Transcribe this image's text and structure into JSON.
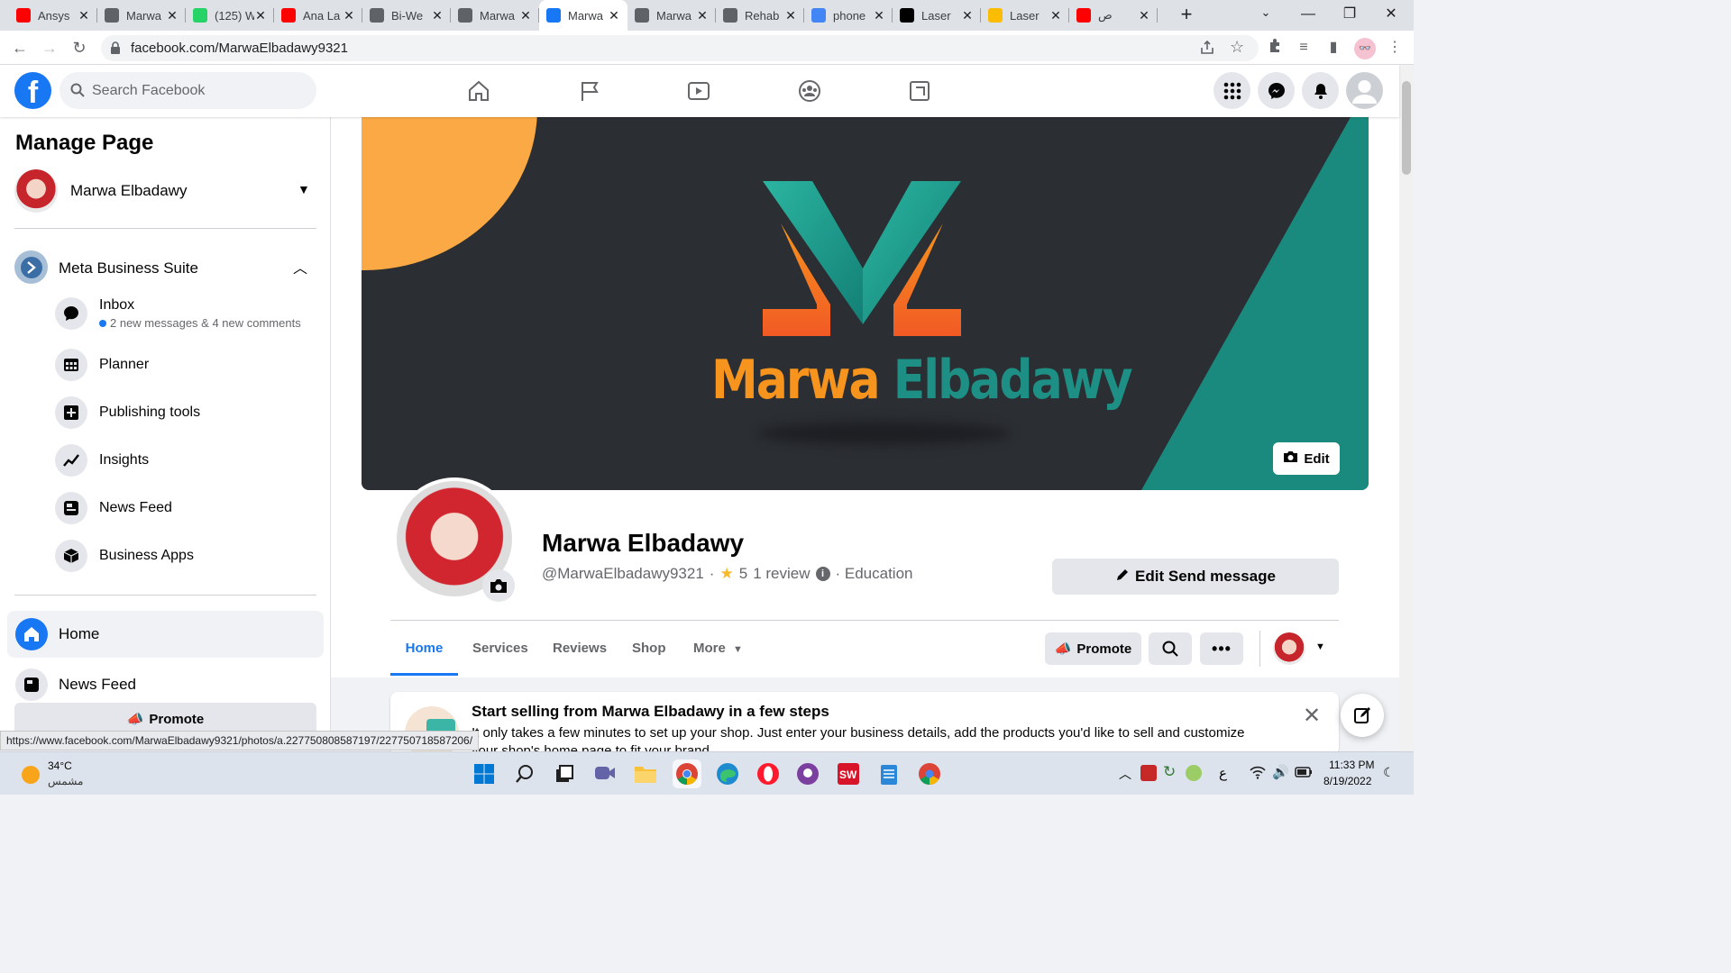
{
  "browser": {
    "tabs": [
      {
        "title": "Ansys",
        "icon": "youtube-icon",
        "color": "#ff0000"
      },
      {
        "title": "Marwa",
        "icon": "globe-icon",
        "color": "#5f6368"
      },
      {
        "title": "(125) W",
        "icon": "whatsapp-icon",
        "color": "#25d366"
      },
      {
        "title": "Ana La",
        "icon": "youtube-icon",
        "color": "#ff0000"
      },
      {
        "title": "Bi-We",
        "icon": "globe-icon",
        "color": "#5f6368"
      },
      {
        "title": "Marwa",
        "icon": "globe-icon",
        "color": "#5f6368"
      },
      {
        "title": "Marwa",
        "icon": "facebook-icon",
        "color": "#1877f2",
        "active": true
      },
      {
        "title": "Marwa",
        "icon": "globe-icon",
        "color": "#5f6368"
      },
      {
        "title": "Rehab",
        "icon": "globe-icon",
        "color": "#5f6368"
      },
      {
        "title": "phone",
        "icon": "google-icon",
        "color": "#4285f4"
      },
      {
        "title": "Laser",
        "icon": "laser-icon",
        "color": "#000000"
      },
      {
        "title": "Laser",
        "icon": "emoji-icon",
        "color": "#fbbc04"
      },
      {
        "title": "ص",
        "icon": "youtube-icon",
        "color": "#ff0000"
      }
    ],
    "url": "facebook.com/MarwaElbadawy9321",
    "status_url": "https://www.facebook.com/MarwaElbadawy9321/photos/a.227750808587197/227750718587206/"
  },
  "fb": {
    "search_placeholder": "Search Facebook",
    "sidebar": {
      "heading": "Manage Page",
      "page_name": "Marwa Elbadawy",
      "suite_label": "Meta Business Suite",
      "items": [
        {
          "label": "Inbox",
          "icon": "chat-bubble-icon"
        },
        {
          "label": "Planner",
          "icon": "calendar-grid-icon"
        },
        {
          "label": "Publishing tools",
          "icon": "publishing-icon"
        },
        {
          "label": "Insights",
          "icon": "insights-icon"
        },
        {
          "label": "News Feed",
          "icon": "news-feed-icon"
        },
        {
          "label": "Business Apps",
          "icon": "box-icon"
        }
      ],
      "inbox_sub": "2 new messages & 4 new comments",
      "home_label": "Home",
      "newsfeed_label": "News Feed",
      "promote_label": "Promote"
    },
    "cover": {
      "brand_first": "Marwa",
      "brand_last": "Elbadawy",
      "edit_label": "Edit"
    },
    "profile": {
      "name": "Marwa Elbadawy",
      "handle": "@MarwaElbadawy9321",
      "separator": "·",
      "rating": "5",
      "reviews": "1 review",
      "category": "· Education",
      "edit_send_label": "Edit Send message"
    },
    "tabs": [
      "Home",
      "Services",
      "Reviews",
      "Shop",
      "More"
    ],
    "promote_btn": "Promote",
    "shop_card": {
      "title": "Start selling from Marwa Elbadawy in a few steps",
      "body": "It only takes a few minutes to set up your shop. Just enter your business details, add the products you'd like to sell and customize",
      "body2": "your shop's home page to fit your brand."
    }
  },
  "taskbar": {
    "temp": "34°C",
    "weather": "مشمس",
    "lang": "ع",
    "time": "11:33 PM",
    "date": "8/19/2022"
  },
  "colors": {
    "fb_blue": "#1877f2",
    "cover_dark": "#2b2e33",
    "teal": "#1a8a7e",
    "orange": "#f7941d",
    "sun": "#fba944"
  }
}
